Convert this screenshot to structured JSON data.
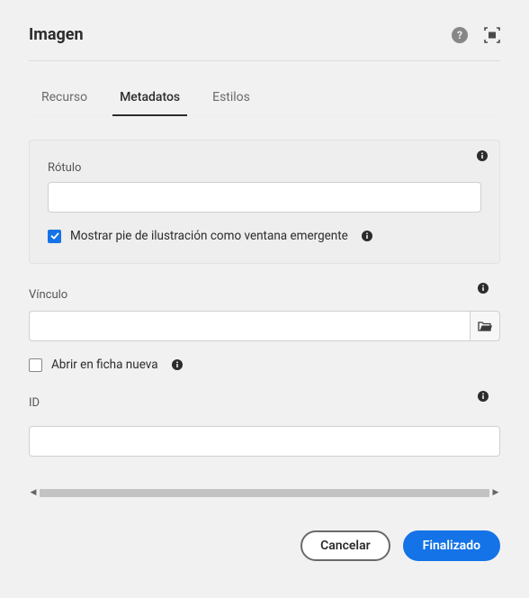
{
  "header": {
    "title": "Imagen"
  },
  "tabs": {
    "items": [
      {
        "label": "Recurso"
      },
      {
        "label": "Metadatos"
      },
      {
        "label": "Estilos"
      }
    ],
    "activeIndex": 1
  },
  "form": {
    "rotulo": {
      "label": "Rótulo",
      "value": ""
    },
    "caption_popup": {
      "label": "Mostrar pie de ilustración como ventana emergente",
      "checked": true
    },
    "vinculo": {
      "label": "Vínculo",
      "value": ""
    },
    "new_tab": {
      "label": "Abrir en ficha nueva",
      "checked": false
    },
    "id": {
      "label": "ID",
      "value": ""
    }
  },
  "footer": {
    "cancel": "Cancelar",
    "done": "Finalizado"
  }
}
